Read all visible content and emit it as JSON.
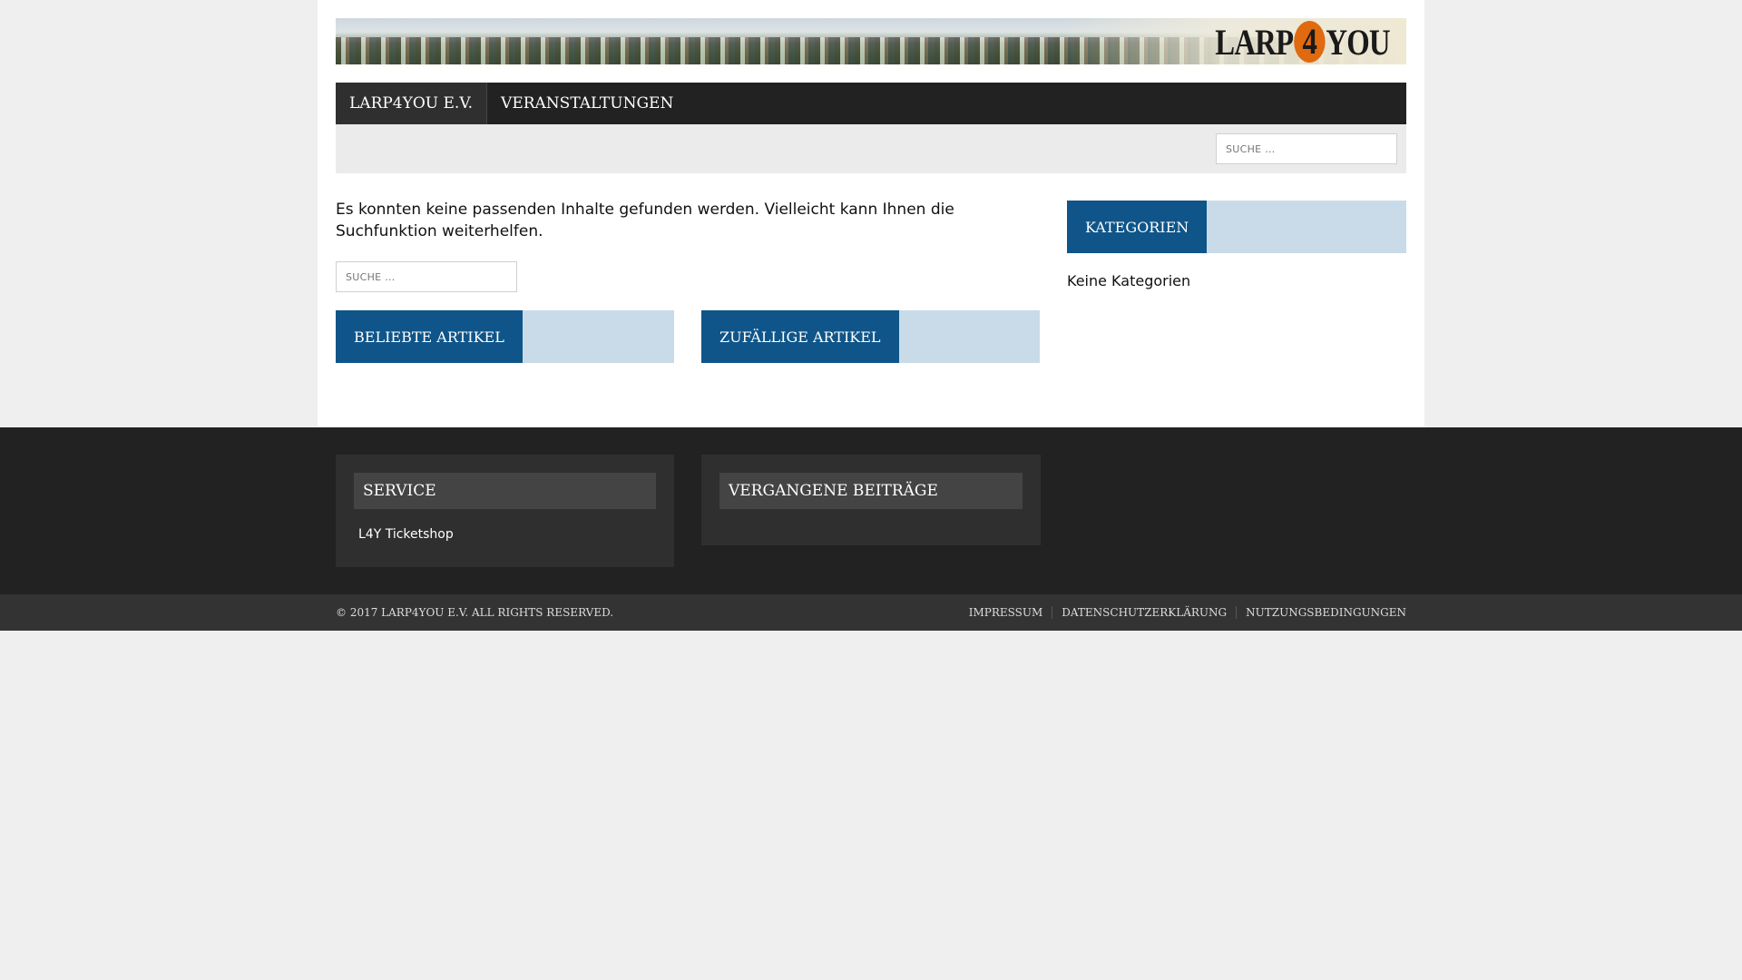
{
  "header": {
    "logo_text_left": "LARP",
    "logo_text_mid": "4",
    "logo_text_right": "YOU"
  },
  "nav": {
    "items": [
      {
        "label": "LARP4YOU E.V."
      },
      {
        "label": "VERANSTALTUNGEN"
      }
    ]
  },
  "search": {
    "placeholder": "SUCHE …"
  },
  "content": {
    "message": "Es konnten keine passenden Inhalte gefunden werden. Vielleicht kann Ihnen die Suchfunktion weiterhelfen.",
    "widgets": {
      "beliebt": "BELIEBTE ARTIKEL",
      "zufall": "ZUFÄLLIGE ARTIKEL"
    }
  },
  "sidebar": {
    "categories_title": "KATEGORIEN",
    "no_categories": "Keine Kategorien"
  },
  "footer": {
    "service_title": "SERVICE",
    "service_link": "L4Y Ticketshop",
    "past_title": "VERGANGENE BEITRÄGE",
    "copyright": "© 2017 LARP4YOU E.V. ALL RIGHTS RESERVED.",
    "links": [
      {
        "label": "IMPRESSUM"
      },
      {
        "label": "DATENSCHUTZERKLÄRUNG"
      },
      {
        "label": "NUTZUNGSBEDINGUNGEN"
      }
    ]
  },
  "colors": {
    "accent": "#0f5589",
    "accent_light": "#c9dbe8",
    "dark": "#222222"
  }
}
